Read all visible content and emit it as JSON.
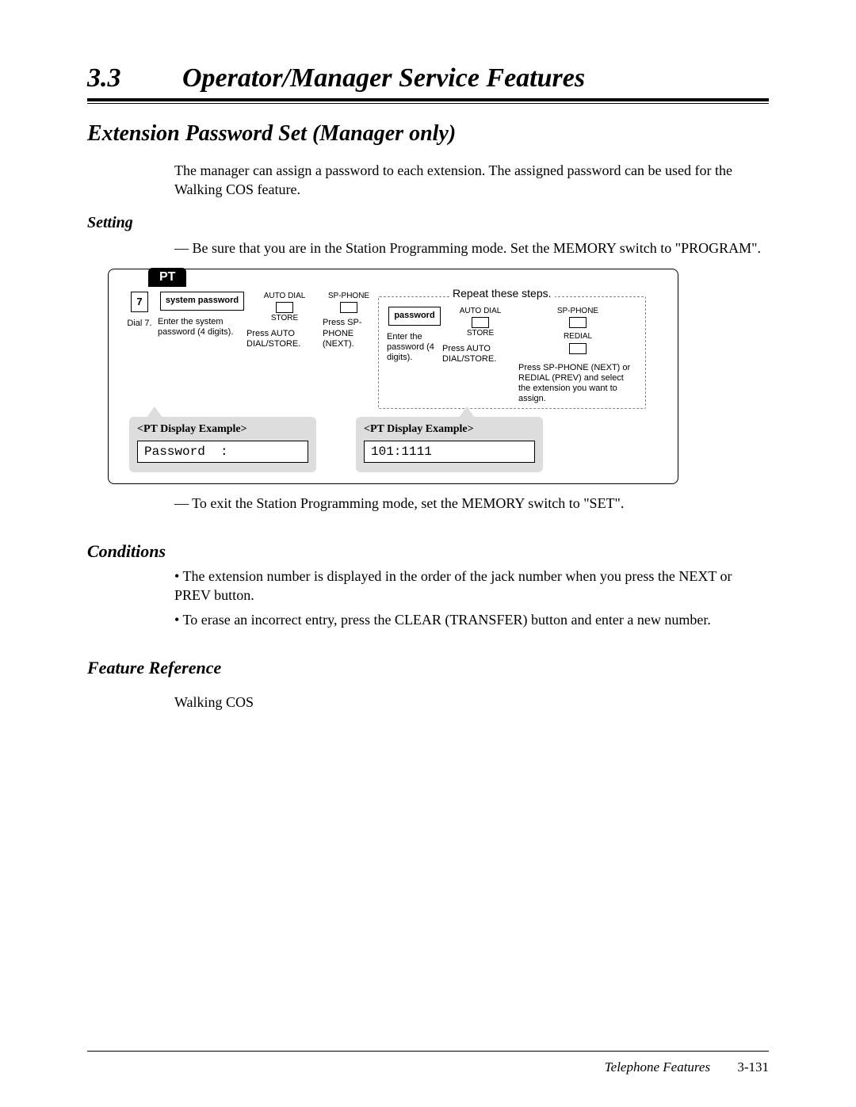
{
  "header": {
    "section_number": "3.3",
    "section_title": "Operator/Manager Service Features"
  },
  "feature": {
    "title_bold": "Extension Password Set",
    "title_italic": " (Manager only)",
    "intro": "The manager can assign a password to each extension. The assigned password can be used for the Walking COS feature."
  },
  "setting": {
    "heading": "Setting",
    "line1": "— Be sure that you are in the Station Programming mode. Set the MEMORY switch to \"PROGRAM\".",
    "line2": "— To exit the Station Programming mode, set the MEMORY switch to \"SET\"."
  },
  "diagram": {
    "pt_label": "PT",
    "repeat_label": "Repeat these steps.",
    "step1": {
      "box": "7",
      "caption": "Dial 7."
    },
    "step2": {
      "box": "system password",
      "caption": "Enter the system password (4 digits)."
    },
    "step3": {
      "top": "AUTO DIAL",
      "bot": "STORE",
      "caption": "Press AUTO DIAL/STORE."
    },
    "step4": {
      "top": "SP-PHONE",
      "caption": "Press SP-PHONE (NEXT)."
    },
    "step5": {
      "box": "password",
      "caption": "Enter the password (4 digits)."
    },
    "step6": {
      "top": "AUTO DIAL",
      "bot": "STORE",
      "caption": "Press AUTO DIAL/STORE."
    },
    "step7": {
      "sp_label": "SP-PHONE",
      "redial_label": "REDIAL",
      "caption": "Press SP-PHONE (NEXT) or REDIAL (PREV) and select the extension you want to assign."
    },
    "example1": {
      "title": "<PT Display Example>",
      "value": "Password  :"
    },
    "example2": {
      "title": "<PT Display Example>",
      "value": "101:1111"
    }
  },
  "conditions": {
    "heading": "Conditions",
    "items": [
      "The extension number is displayed in the order of the jack number when you press the NEXT or PREV button.",
      "To erase an incorrect entry, press the CLEAR (TRANSFER) button and enter a new number."
    ]
  },
  "feature_ref": {
    "heading": "Feature Reference",
    "item": "Walking COS"
  },
  "footer": {
    "book": "Telephone Features",
    "page": "3-131"
  }
}
